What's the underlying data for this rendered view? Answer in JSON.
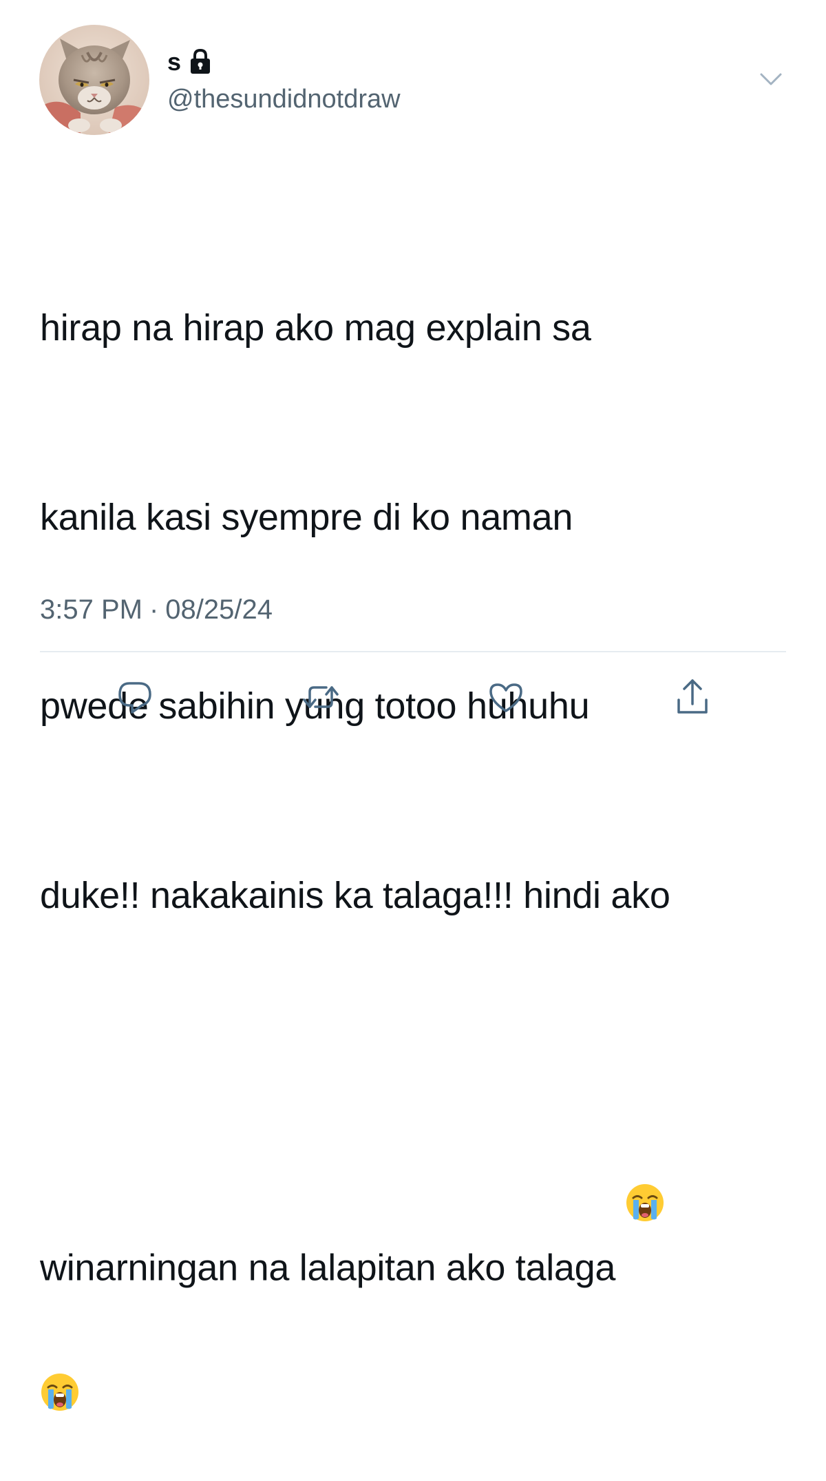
{
  "user": {
    "display_name": "s",
    "handle": "@thesundidnotdraw",
    "avatar_icon": "cat-avatar",
    "protected_icon": "lock-icon"
  },
  "tweet": {
    "lines": [
      "hirap na hirap ako mag explain sa",
      "kanila kasi syempre di ko naman",
      "pwede sabihin yung totoo huhuhu",
      "duke!! nakakainis ka talaga!!! hindi ako",
      "winarningan na lalapitan ako talaga"
    ],
    "emoji": "loudly-crying-face",
    "time": "3:57 PM",
    "separator": "·",
    "date": "08/25/24"
  },
  "actions": [
    {
      "name": "reply",
      "icon": "reply-icon"
    },
    {
      "name": "retweet",
      "icon": "retweet-icon"
    },
    {
      "name": "like",
      "icon": "heart-icon"
    },
    {
      "name": "share",
      "icon": "share-icon"
    }
  ],
  "colors": {
    "text": "#0f1419",
    "secondary": "#536471",
    "divider": "#e6ecf0",
    "icon": "#4a6a85"
  }
}
